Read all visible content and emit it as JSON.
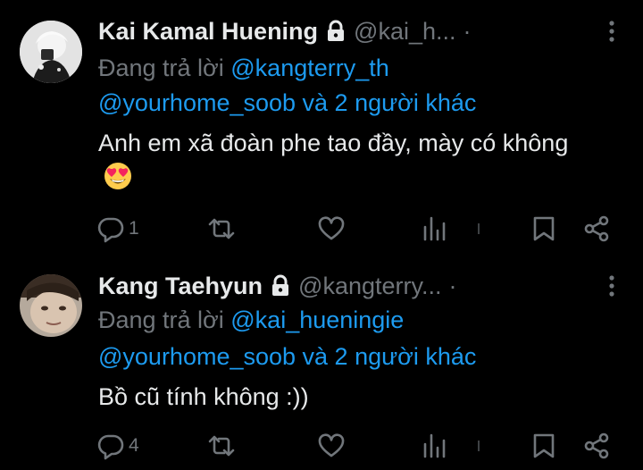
{
  "colors": {
    "background": "#000000",
    "text": "#e7e9ea",
    "secondary": "#71767b",
    "link": "#1d9bf0"
  },
  "tweets": [
    {
      "display_name": "Kai Kamal Huening",
      "handle": "@kai_h...",
      "separator": "·",
      "reply_prefix": "Đang trả lời ",
      "reply_to": "@kangterry_th",
      "mentions": "@yourhome_soob và 2 người khác",
      "text": "Anh em xã đoàn phe tao đầy, mày có không",
      "emoji": "heart-eyes-emoji",
      "replies": "1",
      "retweets": "",
      "likes": "",
      "views": ""
    },
    {
      "display_name": "Kang Taehyun",
      "handle": "@kangterry...",
      "separator": "·",
      "reply_prefix": "Đang trả lời ",
      "reply_to": "@kai_hueningie",
      "mentions": "@yourhome_soob và 2 người khác",
      "text": "Bồ cũ tính không :))",
      "replies": "4",
      "retweets": "",
      "likes": "",
      "views": ""
    }
  ]
}
